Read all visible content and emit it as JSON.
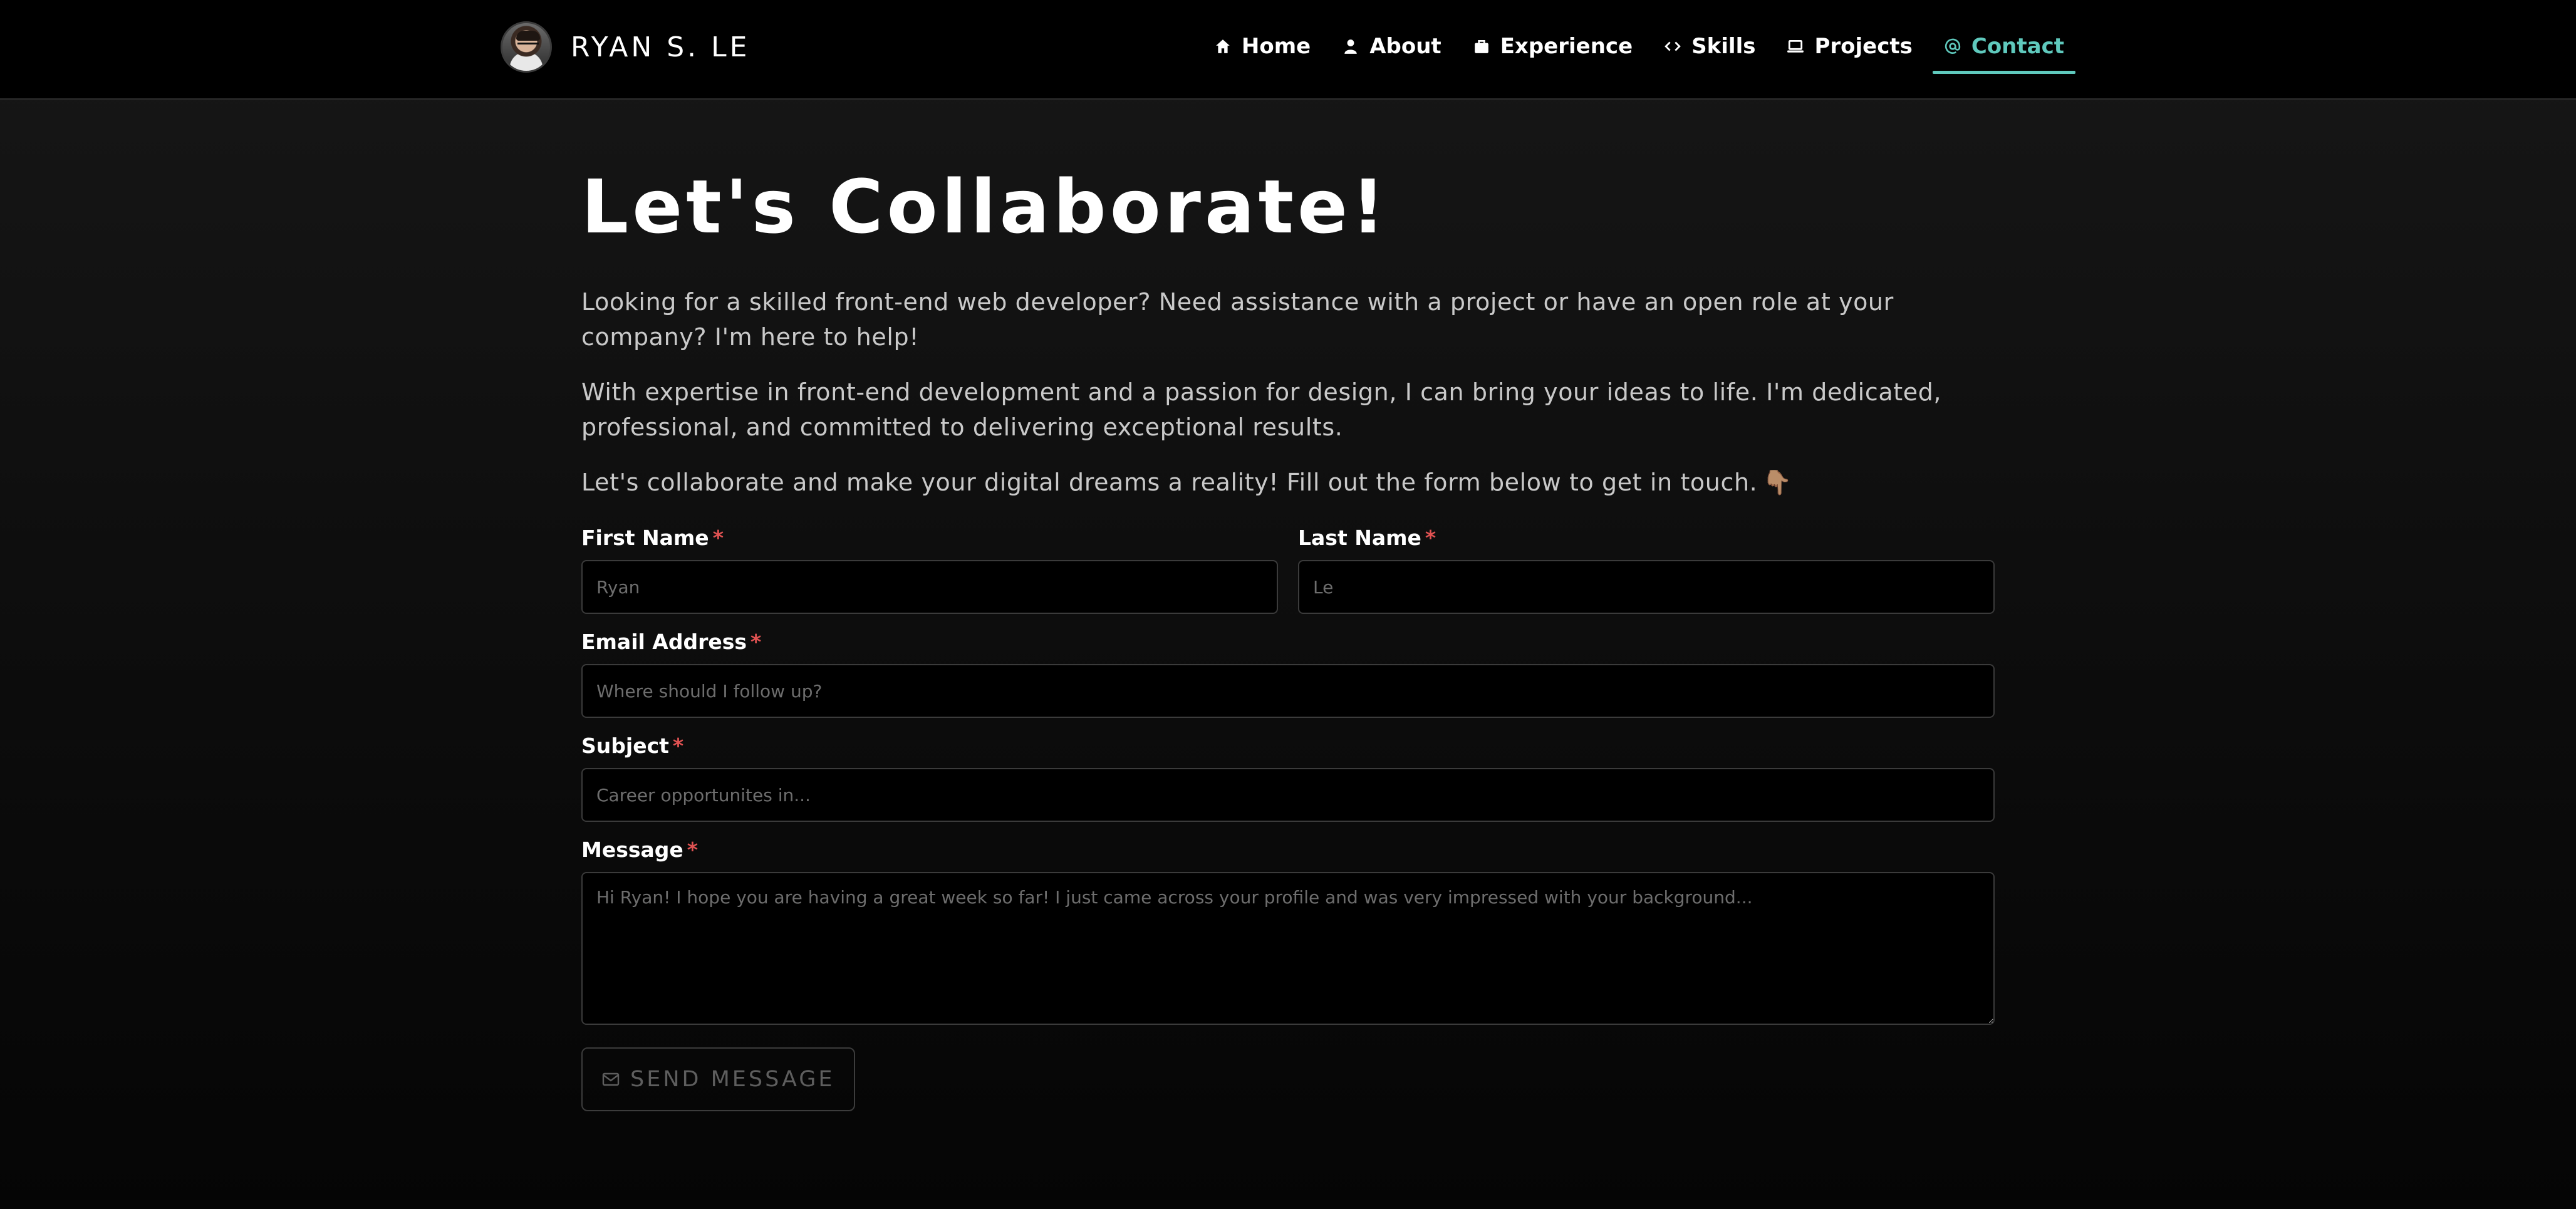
{
  "brand": {
    "name": "RYAN S. LE",
    "avatar_icon": "avatar-photo"
  },
  "nav": {
    "items": [
      {
        "label": "Home",
        "icon": "home-icon"
      },
      {
        "label": "About",
        "icon": "person-icon"
      },
      {
        "label": "Experience",
        "icon": "briefcase-icon"
      },
      {
        "label": "Skills",
        "icon": "code-icon"
      },
      {
        "label": "Projects",
        "icon": "laptop-icon"
      },
      {
        "label": "Contact",
        "icon": "at-icon",
        "active": true
      }
    ],
    "accent_color": "#5fc9bd"
  },
  "hero": {
    "title": "Let's Collaborate!",
    "paragraphs": [
      "Looking for a skilled front-end web developer? Need assistance with a project or have an open role at your company? I'm here to help!",
      "With expertise in front-end development and a passion for design, I can bring your ideas to life. I'm dedicated, professional, and committed to delivering exceptional results.",
      "Let's collaborate and make your digital dreams a reality! Fill out the form below to get in touch."
    ],
    "pointing_emoji": "👇🏽"
  },
  "form": {
    "required_marker": "*",
    "first_name": {
      "label": "First Name",
      "placeholder": "Ryan",
      "value": ""
    },
    "last_name": {
      "label": "Last Name",
      "placeholder": "Le",
      "value": ""
    },
    "email": {
      "label": "Email Address",
      "placeholder": "Where should I follow up?",
      "value": ""
    },
    "subject": {
      "label": "Subject",
      "placeholder": "Career opportunites in...",
      "value": ""
    },
    "message": {
      "label": "Message",
      "placeholder": "Hi Ryan! I hope you are having a great week so far! I just came across your profile and was very impressed with your background...",
      "value": ""
    },
    "submit": {
      "label": "SEND MESSAGE",
      "icon": "envelope-icon",
      "state": "disabled"
    },
    "required_color": "#e05252"
  }
}
